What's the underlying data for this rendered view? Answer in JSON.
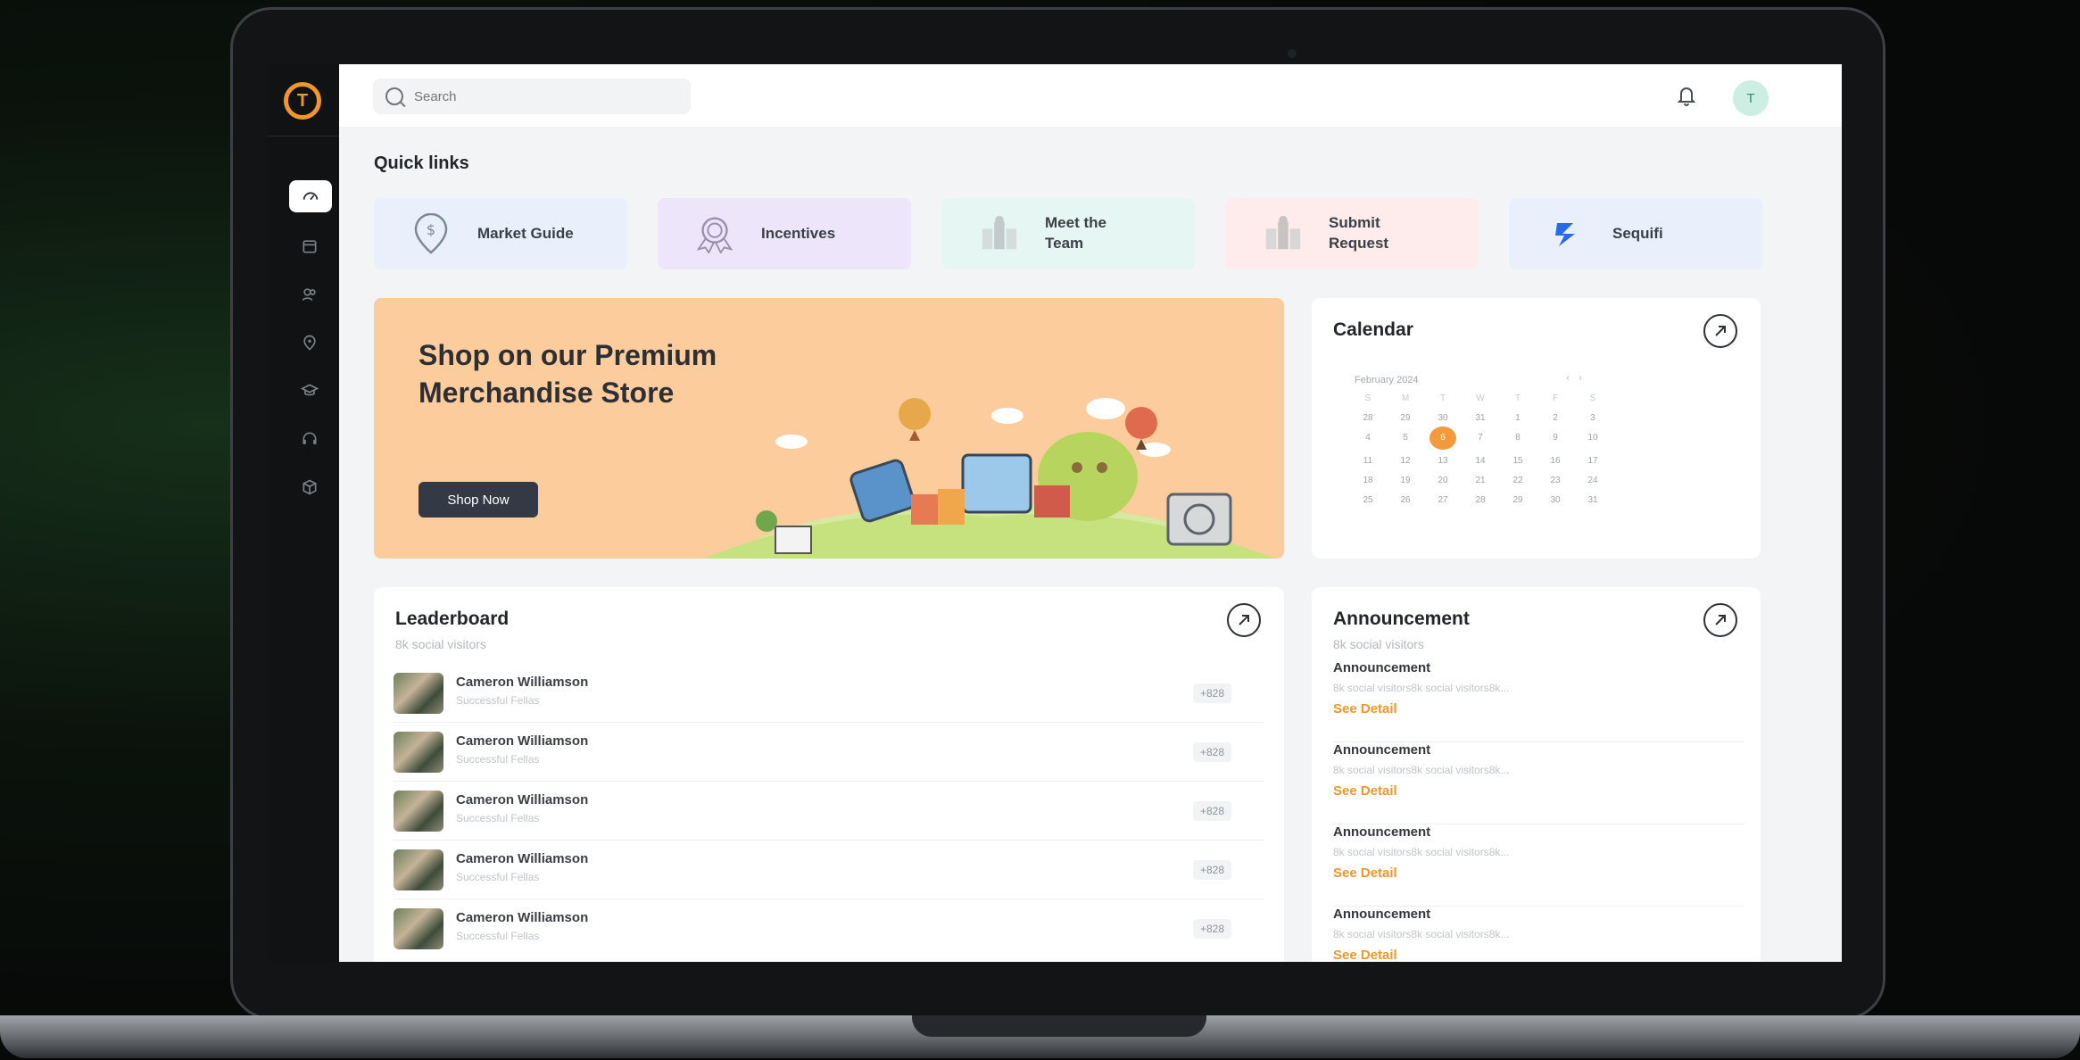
{
  "topbar": {
    "search_placeholder": "Search",
    "avatar_initial": "T"
  },
  "quick_links": {
    "title": "Quick links",
    "items": [
      {
        "label": "Market Guide",
        "bg": "#e9f0fc",
        "icon": "location-pin-icon"
      },
      {
        "label": "Incentives",
        "bg": "#ede6fb",
        "icon": "badge-icon"
      },
      {
        "label": "Meet the Team",
        "bg": "#e6f7f3",
        "icon": "team-icon"
      },
      {
        "label": "Submit Request",
        "bg": "#fdeceb",
        "icon": "request-icon"
      },
      {
        "label": "Sequifi",
        "bg": "#e9f0fc",
        "icon": "sequifi-logo-icon"
      }
    ]
  },
  "banner": {
    "title": "Shop on our Premium Merchandise Store",
    "button": "Shop Now",
    "bg": "#fccc9d"
  },
  "calendar": {
    "title": "Calendar",
    "month": "February 2024",
    "weekdays": [
      "S",
      "M",
      "T",
      "W",
      "T",
      "F",
      "S"
    ],
    "weeks": [
      [
        "28",
        "29",
        "30",
        "31",
        "1",
        "2",
        "3"
      ],
      [
        "4",
        "5",
        "6",
        "7",
        "8",
        "9",
        "10"
      ],
      [
        "11",
        "12",
        "13",
        "14",
        "15",
        "16",
        "17"
      ],
      [
        "18",
        "19",
        "20",
        "21",
        "22",
        "23",
        "24"
      ],
      [
        "25",
        "26",
        "27",
        "28",
        "29",
        "30",
        "31"
      ]
    ],
    "selected": "6",
    "accent": "#f39a3c"
  },
  "leaderboard": {
    "title": "Leaderboard",
    "subtitle": "8k social visitors",
    "rows": [
      {
        "name": "Cameron Williamson",
        "desc": "Successful Fellas",
        "score": "+828"
      },
      {
        "name": "Cameron Williamson",
        "desc": "Successful Fellas",
        "score": "+828"
      },
      {
        "name": "Cameron Williamson",
        "desc": "Successful Fellas",
        "score": "+828"
      },
      {
        "name": "Cameron Williamson",
        "desc": "Successful Fellas",
        "score": "+828"
      },
      {
        "name": "Cameron Williamson",
        "desc": "Successful Fellas",
        "score": "+828"
      }
    ]
  },
  "announcement": {
    "title": "Announcement",
    "subtitle": "8k social visitors",
    "items": [
      {
        "title": "Announcement",
        "text": "8k social visitors8k social visitors8k...",
        "link": "See Detail"
      },
      {
        "title": "Announcement",
        "text": "8k social visitors8k social visitors8k...",
        "link": "See Detail"
      },
      {
        "title": "Announcement",
        "text": "8k social visitors8k social visitors8k...",
        "link": "See Detail"
      },
      {
        "title": "Announcement",
        "text": "8k social visitors8k social visitors8k...",
        "link": "See Detail"
      }
    ]
  },
  "sidebar": {
    "items": [
      {
        "icon": "dashboard-icon"
      },
      {
        "icon": "calendar-icon"
      },
      {
        "icon": "team-icon"
      },
      {
        "icon": "location-icon"
      },
      {
        "icon": "education-icon"
      },
      {
        "icon": "support-headset-icon"
      },
      {
        "icon": "box-icon"
      }
    ]
  }
}
